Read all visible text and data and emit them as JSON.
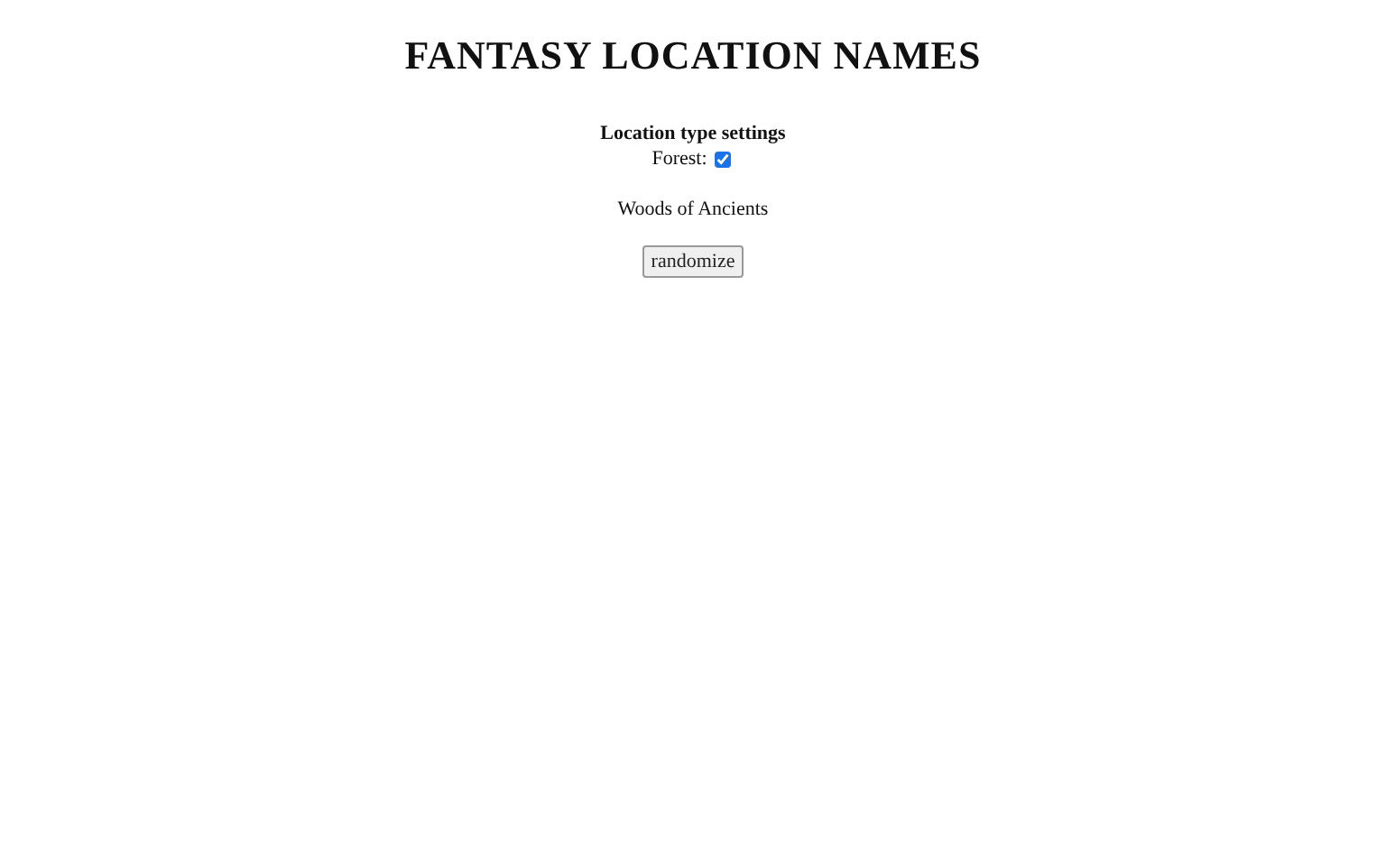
{
  "title": "FANTASY LOCATION NAMES",
  "settings": {
    "heading": "Location type settings",
    "options": [
      {
        "label": "Forest:",
        "checked": true
      }
    ]
  },
  "result": "Woods of Ancients",
  "buttons": [
    "randomize"
  ]
}
